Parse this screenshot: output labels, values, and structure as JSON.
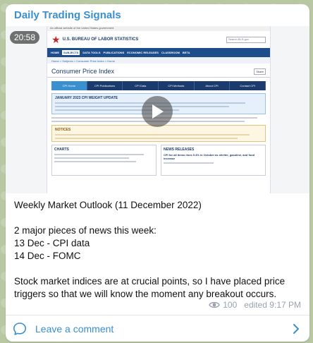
{
  "channel": {
    "name": "Daily Trading Signals"
  },
  "video": {
    "duration": "20:58",
    "screenshot": {
      "gov_strip": "An official website of the United States government",
      "site_title": "U.S. BUREAU OF LABOR STATISTICS",
      "search_placeholder": "Search BLS.gov",
      "nav": [
        "HOME",
        "SUBJECTS",
        "DATA TOOLS",
        "PUBLICATIONS",
        "ECONOMIC RELEASES",
        "CLASSROOM",
        "BETA"
      ],
      "breadcrumb": "Home > Subjects > Consumer Price Index > Home",
      "page_title": "Consumer Price Index",
      "share_label": "Share",
      "subtabs": [
        "CPI Home",
        "CPI Publications",
        "CPI Data",
        "CPI Methods",
        "About CPI",
        "Contact CPI"
      ],
      "notice_title": "JANUARY 2023 CPI WEIGHT UPDATE",
      "notes_title": "NOTICES",
      "charts_title": "CHARTS",
      "news_title": "NEWS RELEASES",
      "news_item": "CPI for all items rises 0.4% in October as shelter, gasoline, and food increase"
    }
  },
  "message": {
    "lines": [
      "Weekly Market Outlook (11 December 2022)",
      "",
      "2 major pieces of news this week:",
      "13 Dec - CPI data",
      "14 Dec - FOMC",
      "",
      "Stock market indices are at crucial points, so I have placed price triggers so that we will know the moment any breakout occurs."
    ]
  },
  "meta": {
    "views": "100",
    "edited": "edited 9:17 PM"
  },
  "comments": {
    "label": "Leave a comment"
  },
  "colors": {
    "accent": "#3a8fcf",
    "meta_gray": "#9aa3ad"
  }
}
